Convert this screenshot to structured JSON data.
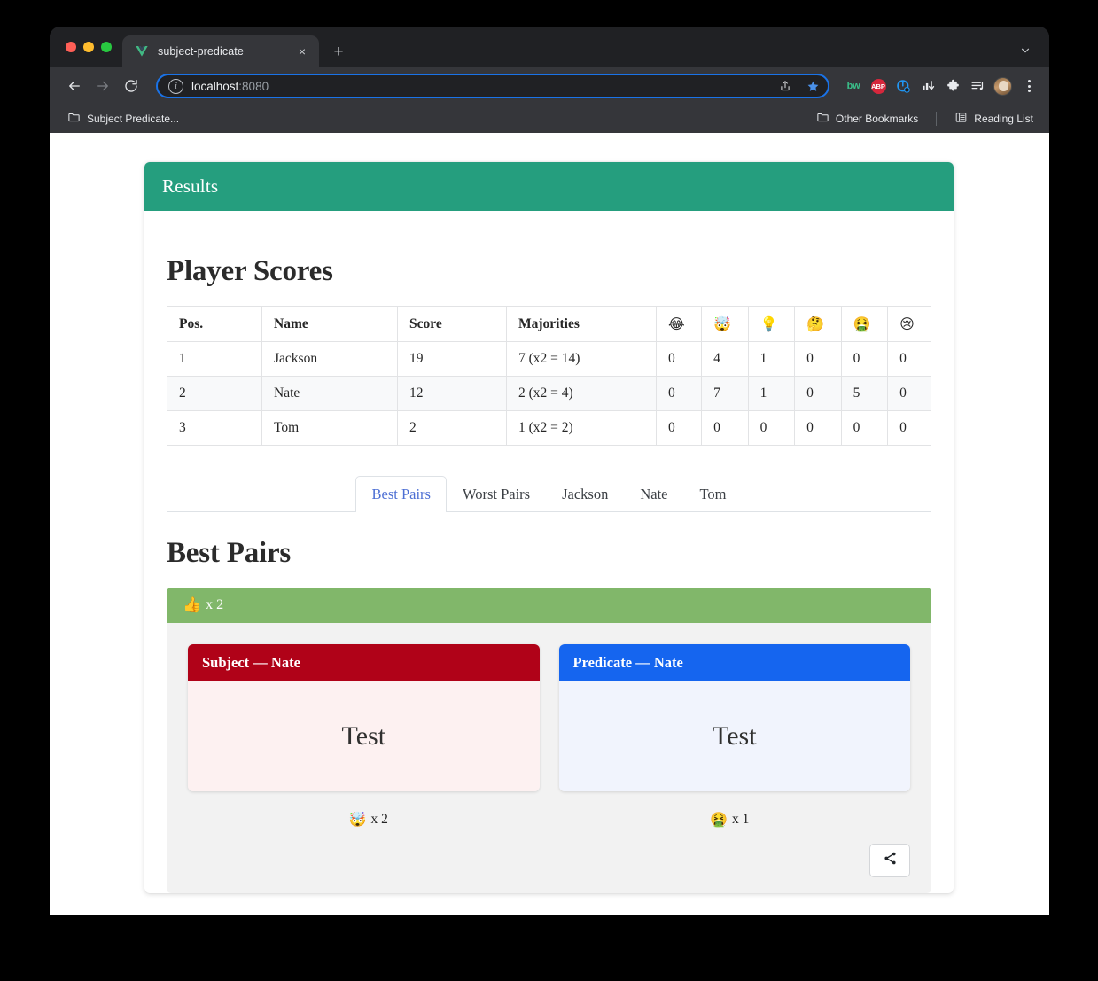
{
  "browser": {
    "tab": {
      "title": "subject-predicate",
      "favicon": "vue-logo-icon",
      "close_label": "×"
    },
    "new_tab_label": "+",
    "nav": {
      "back_label": "←",
      "forward_label": "→",
      "reload_label": "⟳"
    },
    "omnibox": {
      "info_label": "i",
      "url_host": "localhost",
      "url_port": ":8080",
      "share_label": "share-icon",
      "bookmark_label": "star-icon"
    },
    "extensions": [
      {
        "name": "bitwarden",
        "label": "bw"
      },
      {
        "name": "adblock-plus",
        "label": "ABP"
      },
      {
        "name": "blue-circle-extension",
        "label": ""
      },
      {
        "name": "bar-chart-extension",
        "label": ""
      },
      {
        "name": "extensions-puzzle",
        "label": ""
      },
      {
        "name": "playlist-extension",
        "label": ""
      }
    ],
    "bookmarks": {
      "folder": "Subject Predicate...",
      "other_bookmarks": "Other Bookmarks",
      "reading_list": "Reading List"
    }
  },
  "page": {
    "panel_title": "Results",
    "scores_title": "Player Scores",
    "table": {
      "headers": [
        "Pos.",
        "Name",
        "Score",
        "Majorities"
      ],
      "emoji_headers": [
        "😂",
        "🤯",
        "💡",
        "🤔",
        "🤮",
        "😢"
      ],
      "rows": [
        {
          "pos": "1",
          "name": "Jackson",
          "score": "19",
          "majorities": "7 (x2 = 14)",
          "emoji_counts": [
            "0",
            "4",
            "1",
            "0",
            "0",
            "0"
          ]
        },
        {
          "pos": "2",
          "name": "Nate",
          "score": "12",
          "majorities": "2 (x2 = 4)",
          "emoji_counts": [
            "0",
            "7",
            "1",
            "0",
            "5",
            "0"
          ]
        },
        {
          "pos": "3",
          "name": "Tom",
          "score": "2",
          "majorities": "1 (x2 = 2)",
          "emoji_counts": [
            "0",
            "0",
            "0",
            "0",
            "0",
            "0"
          ]
        }
      ]
    },
    "tabs": [
      {
        "label": "Best Pairs",
        "active": true
      },
      {
        "label": "Worst Pairs",
        "active": false
      },
      {
        "label": "Jackson",
        "active": false
      },
      {
        "label": "Nate",
        "active": false
      },
      {
        "label": "Tom",
        "active": false
      }
    ],
    "best_pairs_title": "Best Pairs",
    "pair": {
      "banner_emoji": "👍",
      "banner_count": "x 2",
      "subject": {
        "header": "Subject — Nate",
        "text": "Test",
        "count_emoji": "🤯",
        "count_label": "x 2"
      },
      "predicate": {
        "header": "Predicate — Nate",
        "text": "Test",
        "count_emoji": "🤮",
        "count_label": "x 1"
      },
      "share_label": "share-icon"
    }
  },
  "colors": {
    "header_teal": "#259e7e",
    "banner_green": "#81b76a",
    "subject_red": "#b00218",
    "predicate_blue": "#1565ef",
    "tab_active_blue": "#4d6fd4"
  }
}
